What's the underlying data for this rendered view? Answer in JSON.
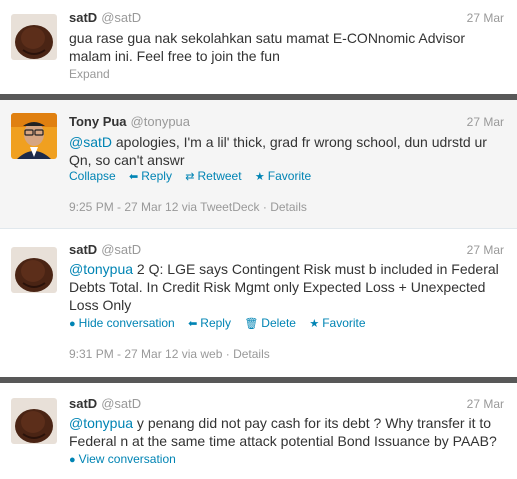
{
  "tweets": [
    {
      "name": "satD",
      "handle": "@satD",
      "time": "27 Mar",
      "text_line1": "gua rase gua nak sekolahkan satu mamat E-CONnomic Advisor",
      "text_line2": "malam ini. Feel free to join the fun",
      "expand": "Expand"
    },
    {
      "name": "Tony Pua",
      "handle": "@tonypua",
      "time": "27 Mar",
      "mention": "@satD",
      "text_line1_rest": " apologies, I'm a lil' thick, grad fr wrong school, dun udrstd ur",
      "text_line2": "Qn, so can't answr",
      "actions": {
        "collapse": "Collapse",
        "reply": "Reply",
        "retweet": "Retweet",
        "favorite": "Favorite"
      },
      "meta": "9:25 PM - 27 Mar 12 via TweetDeck · Details"
    },
    {
      "name": "satD",
      "handle": "@satD",
      "time": "27 Mar",
      "mention": "@tonypua",
      "text_line1_rest": " 2 Q: LGE says Contingent Risk must b included in Federal",
      "text_line2": "Debts Total. In Credit Risk Mgmt only Expected Loss + Unexpected",
      "text_line3": "Loss Only",
      "actions": {
        "hide": "Hide conversation",
        "reply": "Reply",
        "delete": "Delete",
        "favorite": "Favorite"
      },
      "meta": "9:31 PM - 27 Mar 12 via web · Details"
    },
    {
      "name": "satD",
      "handle": "@satD",
      "time": "27 Mar",
      "mention": "@tonypua",
      "text_line1_rest": " y penang did not pay cash for its debt ? Why transfer it to",
      "text_line2": "Federal n at the same time attack potential Bond Issuance by PAAB?",
      "actions": {
        "view": "View conversation"
      }
    }
  ],
  "colors": {
    "link": "#0084b4",
    "muted": "#999999",
    "text": "#333333",
    "separator": "#585858"
  }
}
